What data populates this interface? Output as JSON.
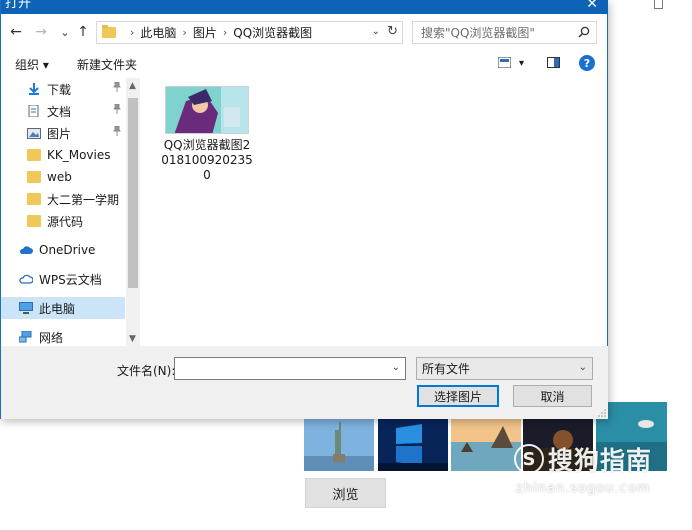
{
  "dialog": {
    "title": "打开",
    "close_glyph": "✕"
  },
  "nav": {
    "back_glyph": "←",
    "forward_glyph": "→",
    "recent_glyph": "⌄",
    "up_glyph": "↑"
  },
  "address": {
    "crumbs": [
      "此电脑",
      "图片",
      "QQ浏览器截图"
    ],
    "separator": "›",
    "dropdown_glyph": "⌄",
    "refresh_glyph": "↻"
  },
  "search": {
    "placeholder": "搜索\"QQ浏览器截图\""
  },
  "toolbar": {
    "organize_label": "组织 ▾",
    "new_folder_label": "新建文件夹",
    "view_dropdown_glyph": "▾",
    "help_glyph": "?"
  },
  "sidebar": {
    "items": [
      {
        "label": "下载",
        "icon": "download-icon",
        "pinned": true
      },
      {
        "label": "文档",
        "icon": "document-icon",
        "pinned": true
      },
      {
        "label": "图片",
        "icon": "pictures-icon",
        "pinned": true
      },
      {
        "label": "KK_Movies",
        "icon": "folder-icon",
        "pinned": false
      },
      {
        "label": "web",
        "icon": "folder-icon",
        "pinned": false
      },
      {
        "label": "大二第一学期",
        "icon": "folder-icon",
        "pinned": false
      },
      {
        "label": "源代码",
        "icon": "folder-icon",
        "pinned": false
      },
      {
        "label": "OneDrive",
        "icon": "cloud-icon",
        "pinned": false
      },
      {
        "label": "WPS云文档",
        "icon": "wps-cloud-icon",
        "pinned": false
      },
      {
        "label": "此电脑",
        "icon": "computer-icon",
        "pinned": false
      },
      {
        "label": "网络",
        "icon": "network-icon",
        "pinned": false
      }
    ],
    "selected": "此电脑",
    "pin_glyph": "📌",
    "scroll_up_glyph": "▲",
    "scroll_down_glyph": "▼"
  },
  "files": [
    {
      "name": "QQ浏览器截图20181009202350"
    }
  ],
  "bottom": {
    "filename_label": "文件名(N):",
    "filename_value": "",
    "filename_dropdown_glyph": "⌄",
    "filetype_value": "所有文件",
    "filetype_dropdown_glyph": "⌄",
    "open_button": "选择图片",
    "cancel_button": "取消"
  },
  "background": {
    "browse_button": "浏览",
    "watermark_text": "搜狗指南",
    "watermark_url": "zhinan.sogou.com",
    "watermark_logo": "S"
  }
}
